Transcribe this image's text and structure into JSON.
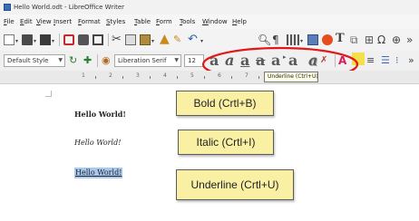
{
  "window": {
    "title": "Hello World.odt - LibreOffice Writer"
  },
  "menu": [
    {
      "label": "File",
      "u": "F",
      "rest": "ile"
    },
    {
      "label": "Edit",
      "u": "E",
      "rest": "dit"
    },
    {
      "label": "View",
      "u": "V",
      "rest": "iew"
    },
    {
      "label": "Insert",
      "u": "I",
      "rest": "nsert"
    },
    {
      "label": "Format",
      "u": "F",
      "rest": "ormat"
    },
    {
      "label": "Styles",
      "u": "S",
      "rest": "tyles"
    },
    {
      "label": "Table",
      "u": "T",
      "rest": "able"
    },
    {
      "label": "Form",
      "u": "F",
      "rest": "orm"
    },
    {
      "label": "Tools",
      "u": "T",
      "rest": "ools"
    },
    {
      "label": "Window",
      "u": "W",
      "rest": "indow"
    },
    {
      "label": "Help",
      "u": "H",
      "rest": "elp"
    }
  ],
  "formatting_bar": {
    "paragraph_style": "Default Style",
    "font_name": "Liberation Serif",
    "font_size": "12",
    "format_glyphs": [
      "a",
      "a",
      "a",
      "a",
      "a",
      "a",
      "a"
    ]
  },
  "tooltip": "Underline (Ctrl+U)",
  "ruler": {
    "numbers": [
      "1",
      "2",
      "3",
      "4",
      "5",
      "6",
      "7"
    ]
  },
  "document": {
    "line_bold": "Hello World!",
    "line_italic": "Hello World!",
    "line_underline": "Hello World!"
  },
  "callouts": {
    "bold": "Bold (Crtl+B)",
    "italic": "Italic (Crtl+I)",
    "underline": "Underline (Crtl+U)"
  },
  "colors": {
    "highlight_ring": "#e01818",
    "callout_fill": "#faf0a4",
    "selection": "#a8c8ef"
  }
}
